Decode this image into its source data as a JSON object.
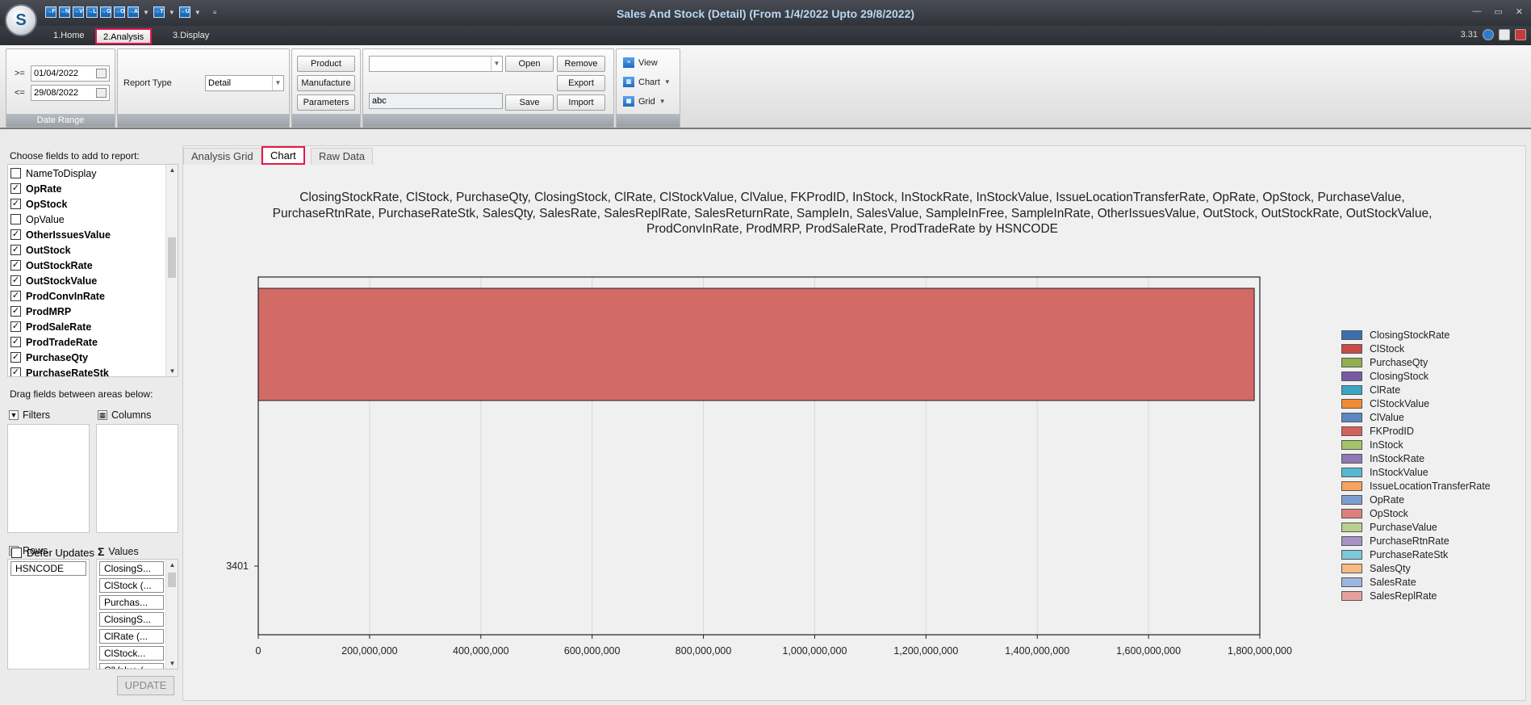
{
  "window": {
    "title": "Sales And Stock (Detail)  (From 1/4/2022 Upto 29/8/2022)",
    "version": "3.31"
  },
  "qat": [
    "→F",
    "→N",
    "→V",
    "→L",
    "→G",
    "→O",
    "→A",
    "→T",
    "→U"
  ],
  "ribbon_tabs": [
    {
      "label": "1.Home"
    },
    {
      "label": "2.Analysis"
    },
    {
      "label": "3.Display"
    }
  ],
  "date_range": {
    "from_label": ">=",
    "from_value": "01/04/2022",
    "to_label": "<=",
    "to_value": "29/08/2022",
    "group_label": "Date Range"
  },
  "report": {
    "type_label": "Report Type",
    "type_value": "Detail"
  },
  "filter_buttons": {
    "product": "Product",
    "manufacture": "Manufacture",
    "parameters": "Parameters"
  },
  "layout_group": {
    "layout_combo_value": "",
    "name_value": "abc",
    "open": "Open",
    "remove": "Remove",
    "export": "Export",
    "save": "Save",
    "import": "Import"
  },
  "view_group": {
    "view": "View",
    "chart": "Chart",
    "grid": "Grid"
  },
  "field_list": {
    "label": "Choose fields to add to report:",
    "items": [
      {
        "name": "NameToDisplay",
        "checked": false
      },
      {
        "name": "OpRate",
        "checked": true
      },
      {
        "name": "OpStock",
        "checked": true
      },
      {
        "name": "OpValue",
        "checked": false
      },
      {
        "name": "OtherIssuesValue",
        "checked": true
      },
      {
        "name": "OutStock",
        "checked": true
      },
      {
        "name": "OutStockRate",
        "checked": true
      },
      {
        "name": "OutStockValue",
        "checked": true
      },
      {
        "name": "ProdConvInRate",
        "checked": true
      },
      {
        "name": "ProdMRP",
        "checked": true
      },
      {
        "name": "ProdSaleRate",
        "checked": true
      },
      {
        "name": "ProdTradeRate",
        "checked": true
      },
      {
        "name": "PurchaseQty",
        "checked": true
      },
      {
        "name": "PurchaseRateStk",
        "checked": true
      }
    ]
  },
  "areas": {
    "drag_label": "Drag fields between areas below:",
    "filters_label": "Filters",
    "columns_label": "Columns",
    "rows_label": "Rows",
    "values_label": "Values",
    "rows": [
      "HSNCODE"
    ],
    "values": [
      "ClosingS...",
      "ClStock (...",
      "Purchas...",
      "ClosingS...",
      "ClRate (...",
      "ClStock...",
      "ClValue (..."
    ]
  },
  "defer": {
    "label": "Defer Updates",
    "checked": false
  },
  "update_label": "UPDATE",
  "main_tabs": [
    {
      "label": "Analysis Grid"
    },
    {
      "label": "Chart"
    },
    {
      "label": "Raw Data"
    }
  ],
  "chart_data": {
    "type": "bar",
    "orientation": "horizontal",
    "title_lines": [
      "ClosingStockRate, ClStock, PurchaseQty, ClosingStock, ClRate, ClStockValue, ClValue, FKProdID, InStock, InStockRate, InStockValue, IssueLocationTransferRate, OpRate, OpStock, PurchaseValue,",
      "PurchaseRtnRate, PurchaseRateStk, SalesQty, SalesRate, SalesReplRate, SalesReturnRate, SampleIn, SalesValue, SampleInFree, SampleInRate, OtherIssuesValue, OutStock, OutStockRate, OutStockValue,",
      "ProdConvInRate, ProdMRP, ProdSaleRate, ProdTradeRate by HSNCODE"
    ],
    "categories": [
      "3401"
    ],
    "series": [
      {
        "name": "ClStock",
        "values": [
          1790000000
        ],
        "color": "#d26a66"
      }
    ],
    "xlim": [
      0,
      1800000000
    ],
    "x_ticks": [
      0,
      200000000,
      400000000,
      600000000,
      800000000,
      1000000000,
      1200000000,
      1400000000,
      1600000000,
      1800000000
    ],
    "x_tick_labels": [
      "0",
      "200,000,000",
      "400,000,000",
      "600,000,000",
      "800,000,000",
      "1,000,000,000",
      "1,200,000,000",
      "1,400,000,000",
      "1,600,000,000",
      "1,800,000,000"
    ],
    "grid": true,
    "legend_position": "right",
    "legend": [
      {
        "name": "ClosingStockRate",
        "color": "#3c6fb0"
      },
      {
        "name": "ClStock",
        "color": "#c94a44"
      },
      {
        "name": "PurchaseQty",
        "color": "#8fb04d"
      },
      {
        "name": "ClosingStock",
        "color": "#7a5ba3"
      },
      {
        "name": "ClRate",
        "color": "#3ba5c4"
      },
      {
        "name": "ClStockValue",
        "color": "#f18c35"
      },
      {
        "name": "ClValue",
        "color": "#5b86c5"
      },
      {
        "name": "FKProdID",
        "color": "#d2625d"
      },
      {
        "name": "InStock",
        "color": "#a4c46a"
      },
      {
        "name": "InStockRate",
        "color": "#9078b6"
      },
      {
        "name": "InStockValue",
        "color": "#58b8d1"
      },
      {
        "name": "IssueLocationTransferRate",
        "color": "#f6a35f"
      },
      {
        "name": "OpRate",
        "color": "#7b9fd2"
      },
      {
        "name": "OpStock",
        "color": "#dd807c"
      },
      {
        "name": "PurchaseValue",
        "color": "#b8d18b"
      },
      {
        "name": "PurchaseRtnRate",
        "color": "#a793c7"
      },
      {
        "name": "PurchaseRateStk",
        "color": "#7cc8dc"
      },
      {
        "name": "SalesQty",
        "color": "#f8ba83"
      },
      {
        "name": "SalesRate",
        "color": "#9cb6de"
      },
      {
        "name": "SalesReplRate",
        "color": "#e6a09c"
      }
    ]
  }
}
